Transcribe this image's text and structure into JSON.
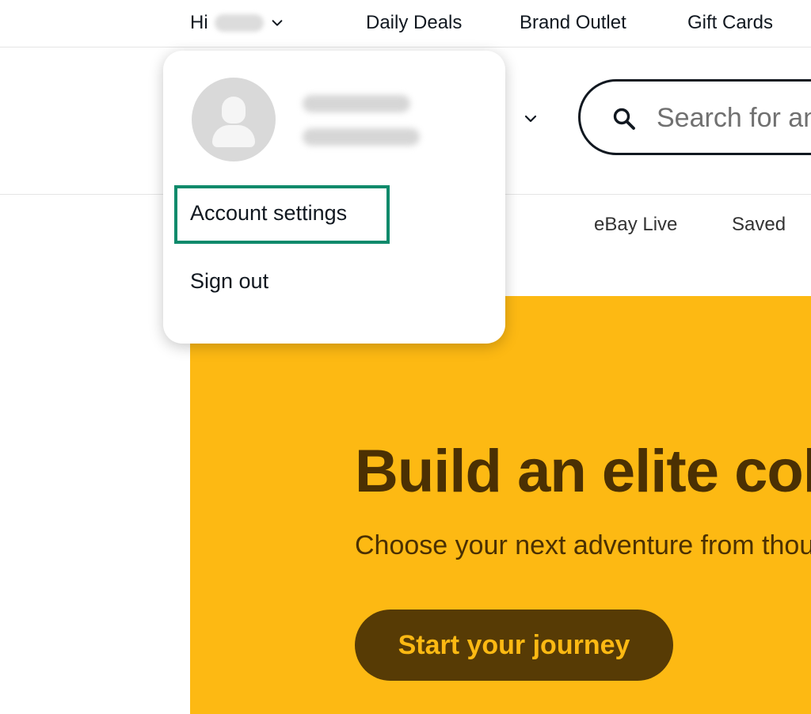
{
  "topbar": {
    "greeting": "Hi",
    "links": [
      "Daily Deals",
      "Brand Outlet",
      "Gift Cards"
    ]
  },
  "search": {
    "placeholder": "Search for anything"
  },
  "secondary_nav": [
    "eBay Live",
    "Saved"
  ],
  "account_menu": {
    "items": [
      "Account settings",
      "Sign out"
    ],
    "highlighted_item": "Account settings"
  },
  "hero": {
    "title": "Build an elite collection",
    "subtitle": "Choose your next adventure from thousands of finds",
    "cta": "Start your journey"
  },
  "colors": {
    "hero_bg": "#fdb913",
    "hero_text": "#4b3003",
    "cta_bg": "#573b05",
    "cta_text": "#fdb913",
    "highlight_border": "#0e8a6b"
  },
  "icons": [
    "chevron-down-icon",
    "search-icon",
    "user-avatar-icon"
  ]
}
